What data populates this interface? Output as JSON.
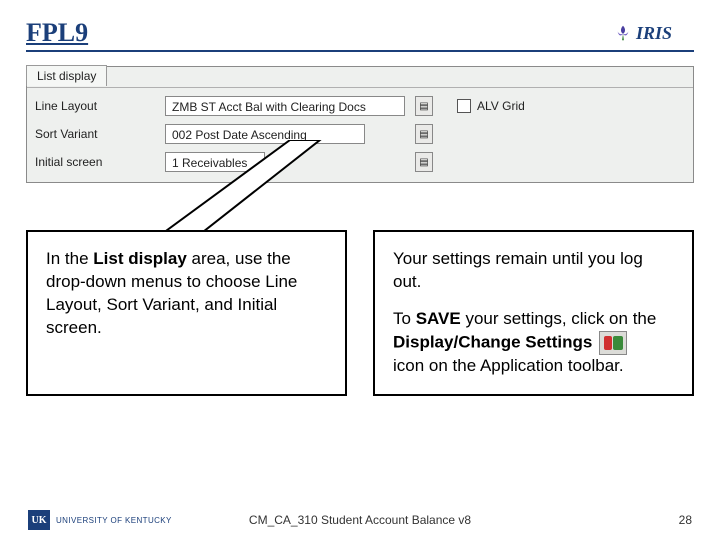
{
  "header": {
    "title": "FPL9",
    "logo_text": "IRIS"
  },
  "sap": {
    "tab_label": "List display",
    "rows": {
      "line_layout": {
        "label": "Line Layout",
        "value": "ZMB ST Acct Bal with Clearing Docs"
      },
      "sort_variant": {
        "label": "Sort Variant",
        "value": "002 Post Date Ascending"
      },
      "initial_screen": {
        "label": "Initial screen",
        "value": "1 Receivables"
      }
    },
    "alv_grid_label": "ALV Grid"
  },
  "callouts": {
    "left": {
      "prefix": "In the ",
      "bold1": "List display",
      "rest": " area, use the drop-down menus to choose Line Layout, Sort Variant, and Initial screen."
    },
    "right": {
      "p1": "Your settings remain until you log out.",
      "p2a": "To ",
      "p2bold1": "SAVE",
      "p2b": " your settings, click on the ",
      "p2bold2": "Display/Change Settings",
      "p2c": " icon on the Application toolbar."
    }
  },
  "footer": {
    "uk_initials": "UK",
    "uk_text": "UNIVERSITY OF KENTUCKY",
    "doc": "CM_CA_310 Student Account Balance v8",
    "page": "28"
  }
}
